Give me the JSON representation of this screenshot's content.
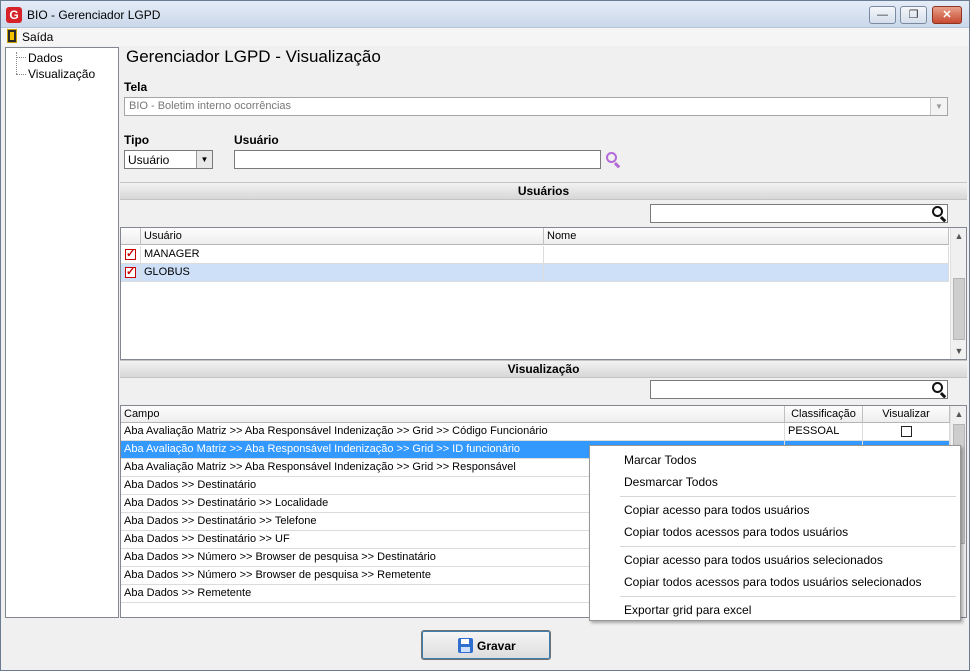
{
  "window": {
    "title": "BIO - Gerenciador LGPD",
    "app_icon_letter": "G"
  },
  "menu": {
    "exit_label": "Saída"
  },
  "tree": {
    "items": [
      "Dados",
      "Visualização"
    ]
  },
  "page": {
    "title": "Gerenciador LGPD - Visualização"
  },
  "form": {
    "tela_label": "Tela",
    "tela_value": "BIO - Boletim interno ocorrências",
    "tipo_label": "Tipo",
    "tipo_value": "Usuário",
    "usuario_label": "Usuário",
    "usuario_value": ""
  },
  "users_section": {
    "header": "Usuários",
    "search_value": "",
    "columns": [
      "Usuário",
      "Nome"
    ],
    "rows": [
      {
        "checked": true,
        "usuario": "MANAGER",
        "nome": ""
      },
      {
        "checked": true,
        "usuario": "GLOBUS",
        "nome": ""
      }
    ]
  },
  "visual_section": {
    "header": "Visualização",
    "search_value": "",
    "columns": [
      "Campo",
      "Classificação",
      "Visualizar"
    ],
    "rows": [
      {
        "campo": "Aba Avaliação Matriz >> Aba Responsável Indenização >> Grid >> Código Funcionário",
        "classificacao": "PESSOAL",
        "visualizar": false
      },
      {
        "campo": "Aba Avaliação Matriz >> Aba Responsável Indenização >> Grid >> ID funcionário",
        "classificacao": "",
        "visualizar": false
      },
      {
        "campo": "Aba Avaliação Matriz >> Aba Responsável Indenização >> Grid >> Responsável",
        "classificacao": "",
        "visualizar": false
      },
      {
        "campo": "Aba Dados >> Destinatário",
        "classificacao": "",
        "visualizar": false
      },
      {
        "campo": "Aba Dados >> Destinatário >> Localidade",
        "classificacao": "",
        "visualizar": false
      },
      {
        "campo": "Aba Dados >> Destinatário >> Telefone",
        "classificacao": "",
        "visualizar": false
      },
      {
        "campo": "Aba Dados >> Destinatário >> UF",
        "classificacao": "",
        "visualizar": false
      },
      {
        "campo": "Aba Dados >> Número >> Browser de pesquisa >> Destinatário",
        "classificacao": "",
        "visualizar": false
      },
      {
        "campo": "Aba Dados >> Número >> Browser de pesquisa >> Remetente",
        "classificacao": "",
        "visualizar": false
      },
      {
        "campo": "Aba Dados >> Remetente",
        "classificacao": "",
        "visualizar": false
      }
    ]
  },
  "context_menu": {
    "items": [
      "Marcar Todos",
      "Desmarcar Todos",
      "Copiar acesso para todos usuários",
      "Copiar todos acessos para todos usuários",
      "Copiar acesso para todos usuários selecionados",
      "Copiar todos acessos para todos usuários selecionados",
      "Exportar grid para excel"
    ]
  },
  "footer": {
    "save_label": "Gravar"
  },
  "colors": {
    "selection": "#3399ff",
    "selection_light": "#cde0f7",
    "check_red": "#c80000",
    "search_accent": "#b26ad8"
  },
  "icons": {
    "app": "app-logo-icon",
    "exit": "exit-door-icon",
    "search": "search-icon",
    "save": "floppy-disk-icon"
  }
}
